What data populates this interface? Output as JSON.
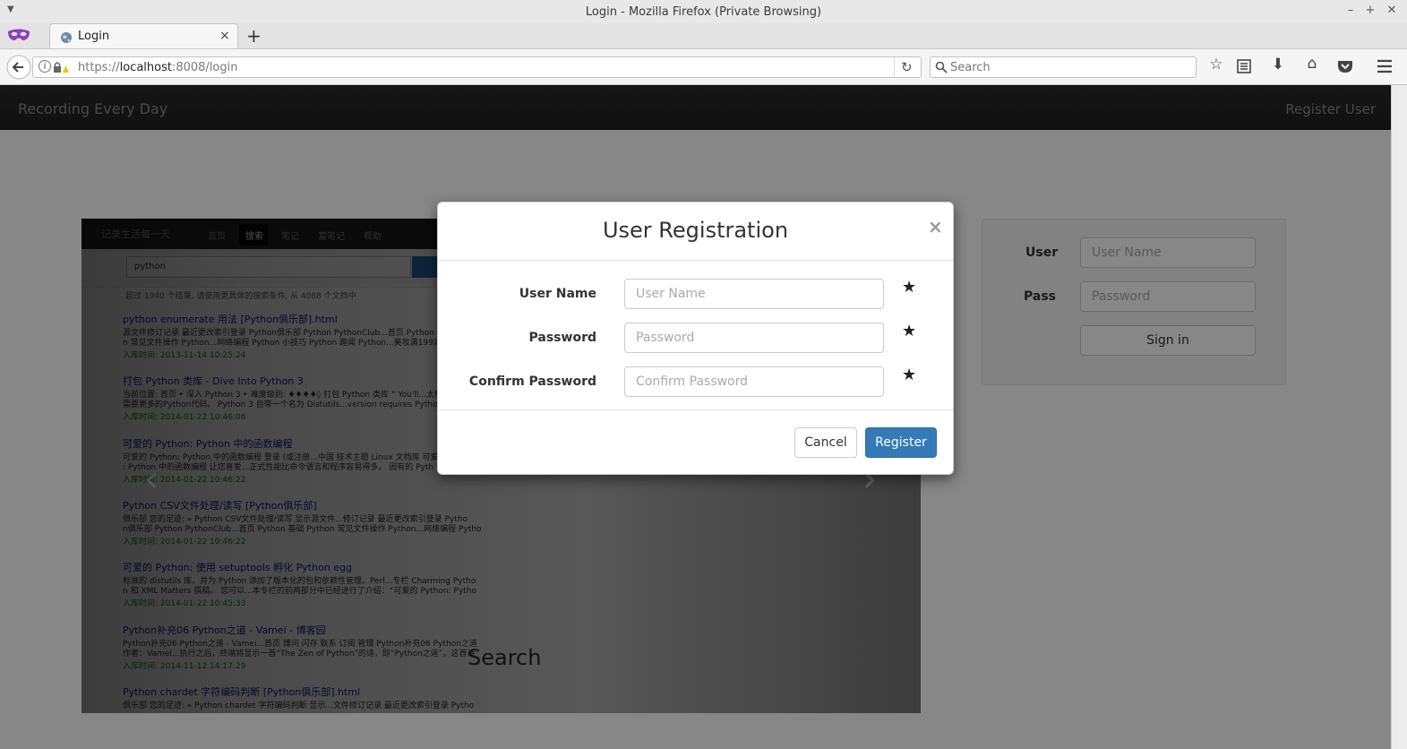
{
  "window": {
    "title": "Login - Mozilla Firefox (Private Browsing)"
  },
  "tab": {
    "label": "Login",
    "close": "×",
    "new_tab": "+"
  },
  "address": {
    "scheme": "https://",
    "host": "localhost",
    "rest": ":8008/login"
  },
  "search": {
    "placeholder": "Search"
  },
  "site": {
    "brand": "Recording Every Day",
    "register_link": "Register User"
  },
  "carousel_shot": {
    "brand": "记录生活每一天",
    "nav": [
      "首页",
      "搜索",
      "笔记",
      "富笔记",
      "帮助"
    ],
    "query": "python",
    "stats": "超过 1940 个结果, 请使用更具体的搜索条件, 从 4088 个文档中",
    "results": [
      {
        "title": "python enumerate 用法 [Python俱乐部].html",
        "snip1": "源文件修订记录 最近更改索引登录 Python俱乐部 Python PythonClub...首页 Python 基",
        "snip2": "n 常见文件操作 Python...网络编程 Python 小技巧 Python 趣闻 Python...美妆满199减1",
        "date": "入库时间: 2013-11-14 10:25:24"
      },
      {
        "title": "打包 Python 类库 - Dive Into Python 3",
        "snip1": "当前位置: 首页 ‣ 深入 Python 3 ‣ 难度级别: ♦♦♦♦◊ 打包 Python 类库 “ You'll...太棒",
        "snip2": "需要更多的Python代码。 Python 3 自带一个名为 Distutils...version requires Python 3",
        "date": "入库时间: 2014-01-22 10:46:06"
      },
      {
        "title": "可爱的 Python: Python 中的函数编程",
        "snip1": "可爱的 Python: Python 中的函数编程 登录 (或注册...中国 技术主题 Linux 文档库 可爱的",
        "snip2": ": Python 中的函数编程 让您喜爱...正式性能比命令语言和程序容易得多。 固有的 Pyth",
        "date": "入库时间: 2014-01-22 10:46:22"
      },
      {
        "title": "Python CSV文件处理/读写 [Python俱乐部]",
        "snip1": "俱乐部 您的足迹: » Python CSV文件处理/读写 显示源文件...修订记录 最近更改索引登录 Pytho",
        "snip2": "n俱乐部 Python PythonClub...首页 Python 基础 Python 常见文件操作 Python...网络编程 Pytho",
        "date": "入库时间: 2014-01-22 10:46:22"
      },
      {
        "title": "可爱的 Python: 使用 setuptools 孵化 Python egg",
        "snip1": "标准的 distutils 库，并为 Python 添加了版本化的包和依赖性管理。Perl...专栏 Charming Pytho",
        "snip2": "n 和 XML Matters 撰稿。 您可以...本专栏的前两部分中已经进行了介绍：“可爱的 Python: Pytho",
        "date": "入库时间: 2014-01-22 10:45:33"
      },
      {
        "title": "Python补充06 Python之道 - Vamei - 博客园",
        "snip1": "Python补充06 Python之道 - Vamei...首页 博问 闪存 联系 订阅 管理 Python补充06 Python之道",
        "snip2": "作者：Vamei...执行之后，终端将显示一首“The Zen of Python”的诗，即“Python之道”。这首诗",
        "date": "入库时间: 2014-11-12 14:17:29"
      },
      {
        "title": "Python chardet 字符编码判断 [Python俱乐部].html",
        "snip1": "俱乐部 您的足迹: » Python chardet 字符编码判断 显示...文件修订记录 最近更改索引登录 Pytho",
        "snip2": "",
        "date": ""
      }
    ],
    "caption": "Search"
  },
  "login_panel": {
    "user_label": "User",
    "user_placeholder": "User Name",
    "pass_label": "Pass",
    "pass_placeholder": "Password",
    "signin": "Sign in"
  },
  "modal": {
    "title": "User Registration",
    "close": "×",
    "fields": [
      {
        "label": "User Name",
        "placeholder": "User Name",
        "required": "★"
      },
      {
        "label": "Password",
        "placeholder": "Password",
        "required": "★"
      },
      {
        "label": "Confirm Password",
        "placeholder": "Confirm Password",
        "required": "★"
      }
    ],
    "cancel": "Cancel",
    "register": "Register"
  }
}
